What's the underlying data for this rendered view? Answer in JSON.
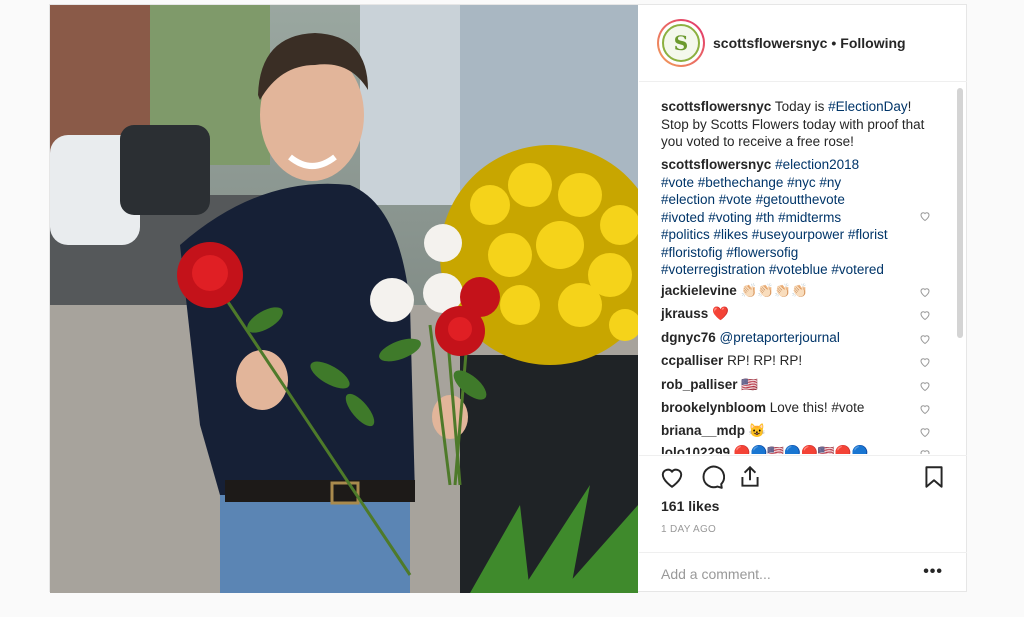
{
  "post": {
    "username": "scottsflowersnyc",
    "separator": "•",
    "follow_status": "Following",
    "avatar_letter": "S",
    "caption": {
      "user": "scottsflowersnyc",
      "text_before": "Today is",
      "hashtag": "#ElectionDay",
      "text_after": "! Stop by Scotts Flowers today with proof that you voted to receive a free rose!"
    },
    "tags_comment": {
      "user": "scottsflowersnyc",
      "lines": [
        "#election2018",
        "#vote #bethechange #nyc #ny",
        "#election #vote #getoutthevote",
        "#ivoted #voting #th #midterms",
        "#politics #likes #useyourpower #florist",
        "#floristofig #flowersofig",
        "#voterregistration #voteblue #votered"
      ]
    },
    "comments": [
      {
        "user": "jackielevine",
        "text": "👏🏻👏🏻👏🏻👏🏻"
      },
      {
        "user": "jkrauss",
        "text": "❤️"
      },
      {
        "user": "dgnyc76",
        "text": "@pretaporterjournal"
      },
      {
        "user": "ccpalliser",
        "text": "RP! RP! RP!"
      },
      {
        "user": "rob_palliser",
        "text": "🇺🇸"
      },
      {
        "user": "brookelynbloom",
        "text": "Love this! #vote"
      },
      {
        "user": "briana__mdp",
        "text": "😺"
      },
      {
        "user": "lolo102299",
        "text": "🔴🔵🇺🇸🔵🔴🇺🇸🔴🔵"
      }
    ],
    "likes": "161 likes",
    "time": "1 DAY AGO",
    "add_comment_placeholder": "Add a comment...",
    "more": "•••",
    "icons": [
      "heart-icon",
      "comment-icon",
      "share-icon",
      "bookmark-icon",
      "more-icon"
    ]
  }
}
